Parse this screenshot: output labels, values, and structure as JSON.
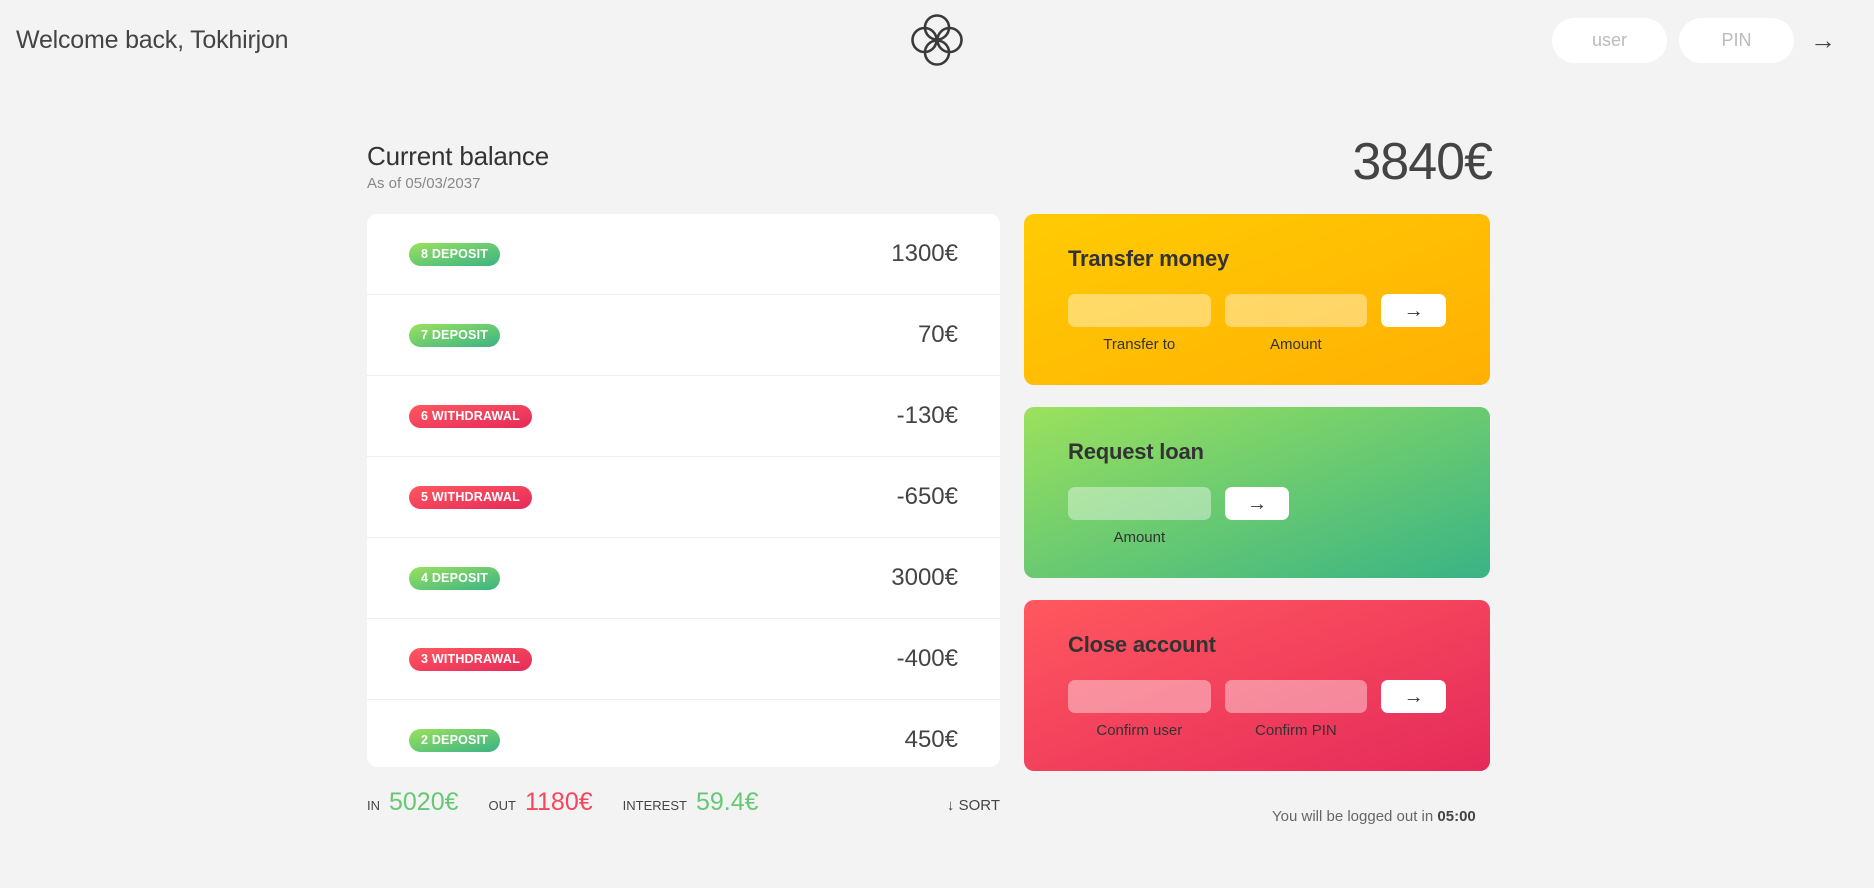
{
  "nav": {
    "welcome": "Welcome back, Tokhirjon",
    "logo_name": "bankist-logo",
    "login": {
      "user_placeholder": "user",
      "user_value": "",
      "pin_placeholder": "PIN",
      "pin_value": "",
      "submit_label": "→"
    }
  },
  "balance": {
    "label": "Current balance",
    "date": "As of 05/03/2037",
    "value": "3840€"
  },
  "movements": [
    {
      "type": "deposit",
      "label": "8 DEPOSIT",
      "value": "1300€"
    },
    {
      "type": "deposit",
      "label": "7 DEPOSIT",
      "value": "70€"
    },
    {
      "type": "withdrawal",
      "label": "6 WITHDRAWAL",
      "value": "-130€"
    },
    {
      "type": "withdrawal",
      "label": "5 WITHDRAWAL",
      "value": "-650€"
    },
    {
      "type": "deposit",
      "label": "4 DEPOSIT",
      "value": "3000€"
    },
    {
      "type": "withdrawal",
      "label": "3 WITHDRAWAL",
      "value": "-400€"
    },
    {
      "type": "deposit",
      "label": "2 DEPOSIT",
      "value": "450€"
    }
  ],
  "operations": {
    "transfer": {
      "title": "Transfer money",
      "to_value": "",
      "amount_value": "",
      "to_label": "Transfer to",
      "amount_label": "Amount",
      "btn_label": "→"
    },
    "loan": {
      "title": "Request loan",
      "amount_value": "",
      "amount_label": "Amount",
      "btn_label": "→"
    },
    "close": {
      "title": "Close account",
      "user_value": "",
      "pin_value": "",
      "user_label": "Confirm user",
      "pin_label": "Confirm PIN",
      "btn_label": "→"
    }
  },
  "summary": {
    "in_label": "IN",
    "in_value": "5020€",
    "out_label": "OUT",
    "out_value": "1180€",
    "interest_label": "INTEREST",
    "interest_value": "59.4€",
    "sort_label": "↓ SORT"
  },
  "logout": {
    "text": "You will be logged out in ",
    "timer": "05:00"
  },
  "colors": {
    "background": "#f3f3f3",
    "deposit_green_light": "#9be15d",
    "deposit_green_dark": "#39b385",
    "withdrawal_red_light": "#ff585f",
    "withdrawal_red_dark": "#e52a5a",
    "transfer_yellow_light": "#ffcb03",
    "transfer_yellow_dark": "#ffb003",
    "summary_in": "#66c873",
    "summary_out": "#f5465d"
  }
}
